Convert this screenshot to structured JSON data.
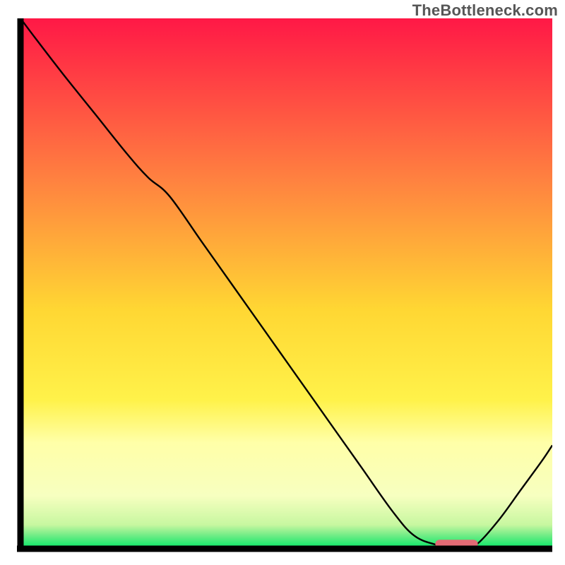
{
  "attribution": "TheBottleneck.com",
  "colors": {
    "axis": "#000000",
    "curve": "#000000",
    "marker_fill": "#e26a74",
    "grad_top": "#ff1846",
    "grad_mid1": "#ffa23a",
    "grad_mid2": "#ffe636",
    "grad_pale": "#ffffb0",
    "grad_green": "#00e865",
    "text": "#565656"
  },
  "chart_data": {
    "type": "line",
    "title": "",
    "xlabel": "",
    "ylabel": "",
    "xlim": [
      0,
      100
    ],
    "ylim": [
      0,
      100
    ],
    "legend": false,
    "grid": false,
    "x": [
      0,
      3,
      8,
      14,
      20,
      24,
      28,
      34,
      40,
      46,
      52,
      58,
      64,
      70,
      74,
      78,
      80,
      84,
      86,
      90,
      94,
      98,
      100
    ],
    "y": [
      100,
      96,
      89.5,
      82,
      74.5,
      70,
      66.5,
      58,
      49.5,
      41,
      32.5,
      24,
      15.5,
      7,
      2.5,
      0.8,
      0.5,
      0.5,
      1,
      5.5,
      11,
      16.5,
      19.5
    ],
    "marker": {
      "x_start": 78,
      "x_end": 86,
      "y": 0.9
    },
    "gradient_stops": [
      {
        "pos": 0.0,
        "color": "#ff1846"
      },
      {
        "pos": 0.3,
        "color": "#ff8040"
      },
      {
        "pos": 0.55,
        "color": "#ffd733"
      },
      {
        "pos": 0.72,
        "color": "#fff24a"
      },
      {
        "pos": 0.8,
        "color": "#ffffa8"
      },
      {
        "pos": 0.9,
        "color": "#f7ffc0"
      },
      {
        "pos": 0.955,
        "color": "#c7f7a0"
      },
      {
        "pos": 0.975,
        "color": "#70ec86"
      },
      {
        "pos": 1.0,
        "color": "#00e865"
      }
    ]
  }
}
